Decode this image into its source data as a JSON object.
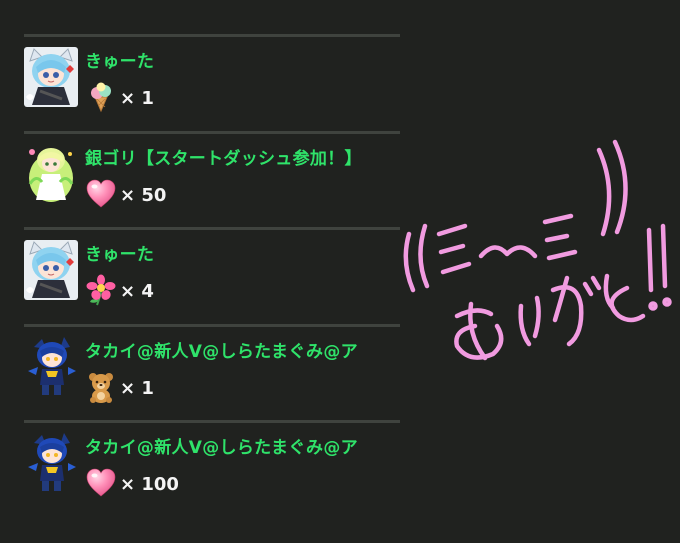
{
  "gift_list": {
    "items": [
      {
        "username": "きゅーた",
        "avatar_icon": "cat-ear-girl-avatar-icon",
        "gift_icon": "ice-cream-icon",
        "count": "× 1"
      },
      {
        "username": "銀ゴリ【スタートダッシュ参加！】",
        "avatar_icon": "green-hair-girl-avatar-icon",
        "gift_icon": "heart-icon",
        "count": "× 50"
      },
      {
        "username": "きゅーた",
        "avatar_icon": "cat-ear-girl-avatar-icon",
        "gift_icon": "pink-flower-icon",
        "count": "× 4"
      },
      {
        "username": "タカイ@新人V@しらたまぐみ@ア",
        "avatar_icon": "blue-chibi-avatar-icon",
        "gift_icon": "teddy-bear-icon",
        "count": "× 1"
      },
      {
        "username": "タカイ@新人V@しらたまぐみ@ア",
        "avatar_icon": "blue-chibi-avatar-icon",
        "gift_icon": "heart-icon",
        "count": "× 100"
      }
    ]
  },
  "colors": {
    "background": "#20221f",
    "divider": "#3f433e",
    "username": "#2fe36a",
    "count": "#f4f4f4",
    "handwriting": "#f19be0"
  },
  "annotation": {
    "handwritten_text": "ありがと!!"
  }
}
